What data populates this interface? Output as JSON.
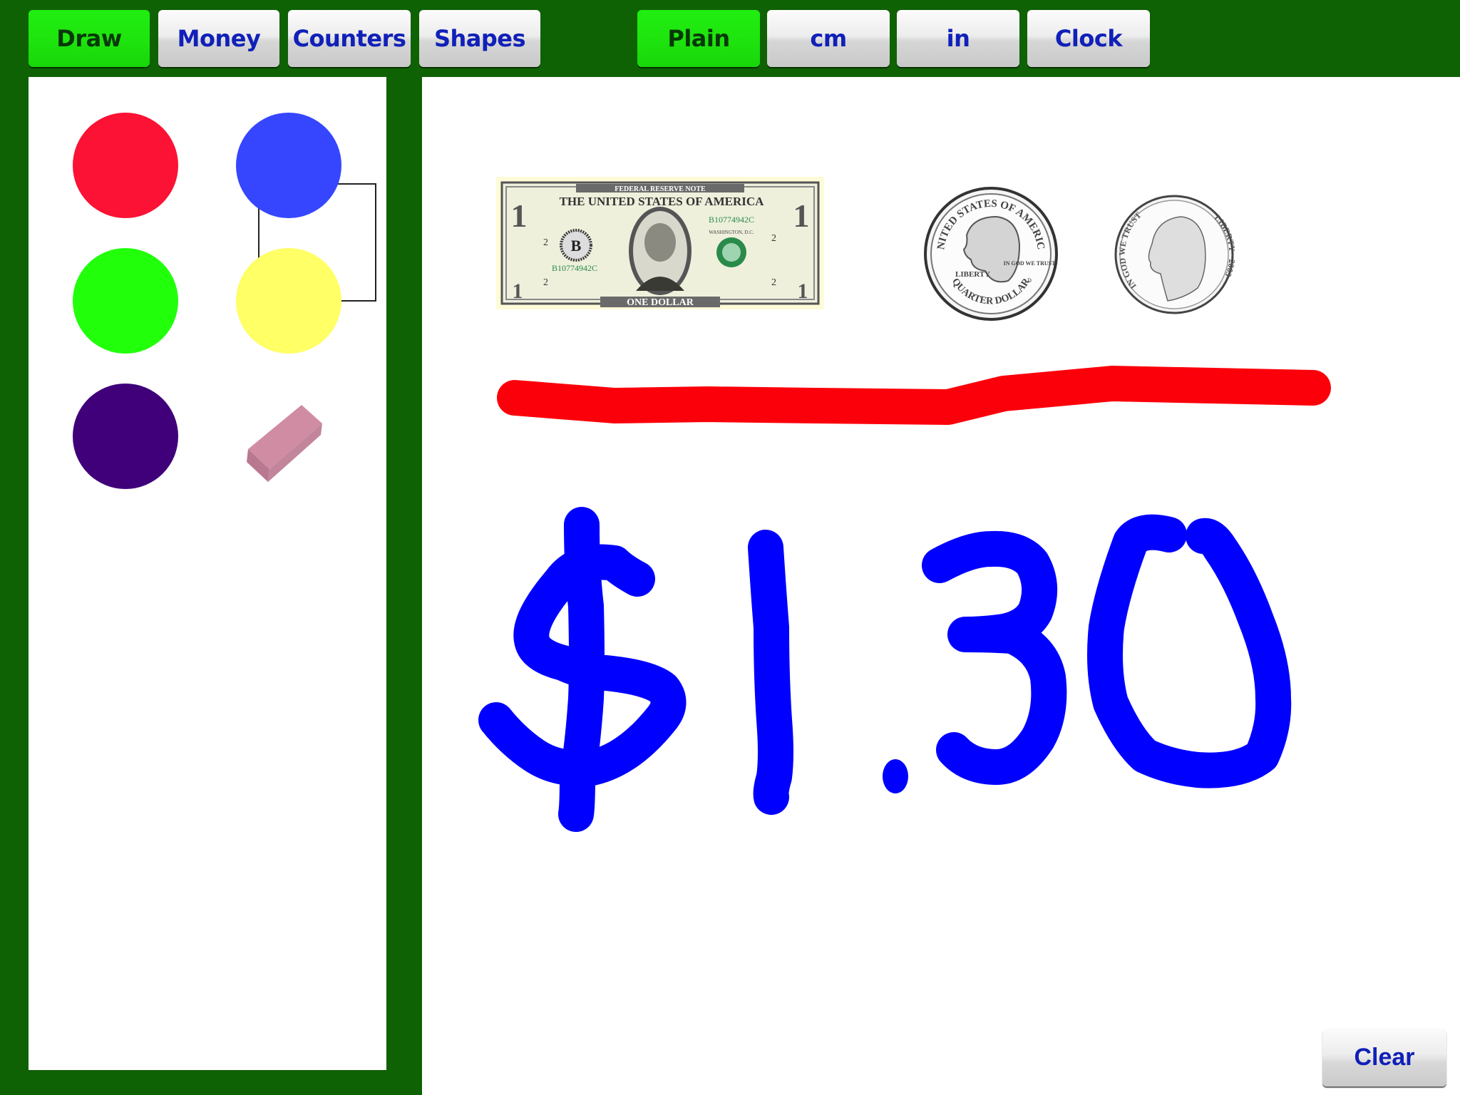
{
  "toolbar": {
    "mode_buttons": [
      {
        "label": "Draw",
        "active": true
      },
      {
        "label": "Money",
        "active": false
      },
      {
        "label": "Counters",
        "active": false
      },
      {
        "label": "Shapes",
        "active": false
      }
    ],
    "background_buttons": [
      {
        "label": "Plain",
        "active": true
      },
      {
        "label": "cm",
        "active": false
      },
      {
        "label": "in",
        "active": false
      },
      {
        "label": "Clock",
        "active": false
      }
    ]
  },
  "palette": {
    "selected": "blue",
    "colors": [
      {
        "name": "red",
        "hex": "#fb1234"
      },
      {
        "name": "blue",
        "hex": "#3646fe"
      },
      {
        "name": "green",
        "hex": "#22ff0b"
      },
      {
        "name": "yellow",
        "hex": "#ffff66"
      },
      {
        "name": "purple",
        "hex": "#3f007a"
      }
    ],
    "eraser": {
      "name": "eraser",
      "hex": "#d08ca2"
    }
  },
  "canvas": {
    "money": {
      "bill": {
        "header": "FEDERAL RESERVE NOTE",
        "title": "THE UNITED STATES OF AMERICA",
        "serial": "B10774942C",
        "city": "WASHINGTON, D.C.",
        "seal_letter": "B",
        "denomination_text": "ONE DOLLAR",
        "corner_value": "1",
        "plate_number": "2"
      },
      "quarter": {
        "top_legend": "UNITED STATES OF AMERICA",
        "left_legend": "LIBERTY",
        "motto": "IN GOD WE TRUST",
        "bottom_legend": "QUARTER DOLLAR",
        "mint_mark": "D"
      },
      "nickel": {
        "left_legend": "IN GOD WE TRUST",
        "right_legend": "LIBERTY · 2003"
      }
    },
    "drawing": {
      "underline_color": "#fb000a",
      "written_text": "$1.30",
      "ink_color": "#0000ff"
    },
    "clear_label": "Clear"
  }
}
